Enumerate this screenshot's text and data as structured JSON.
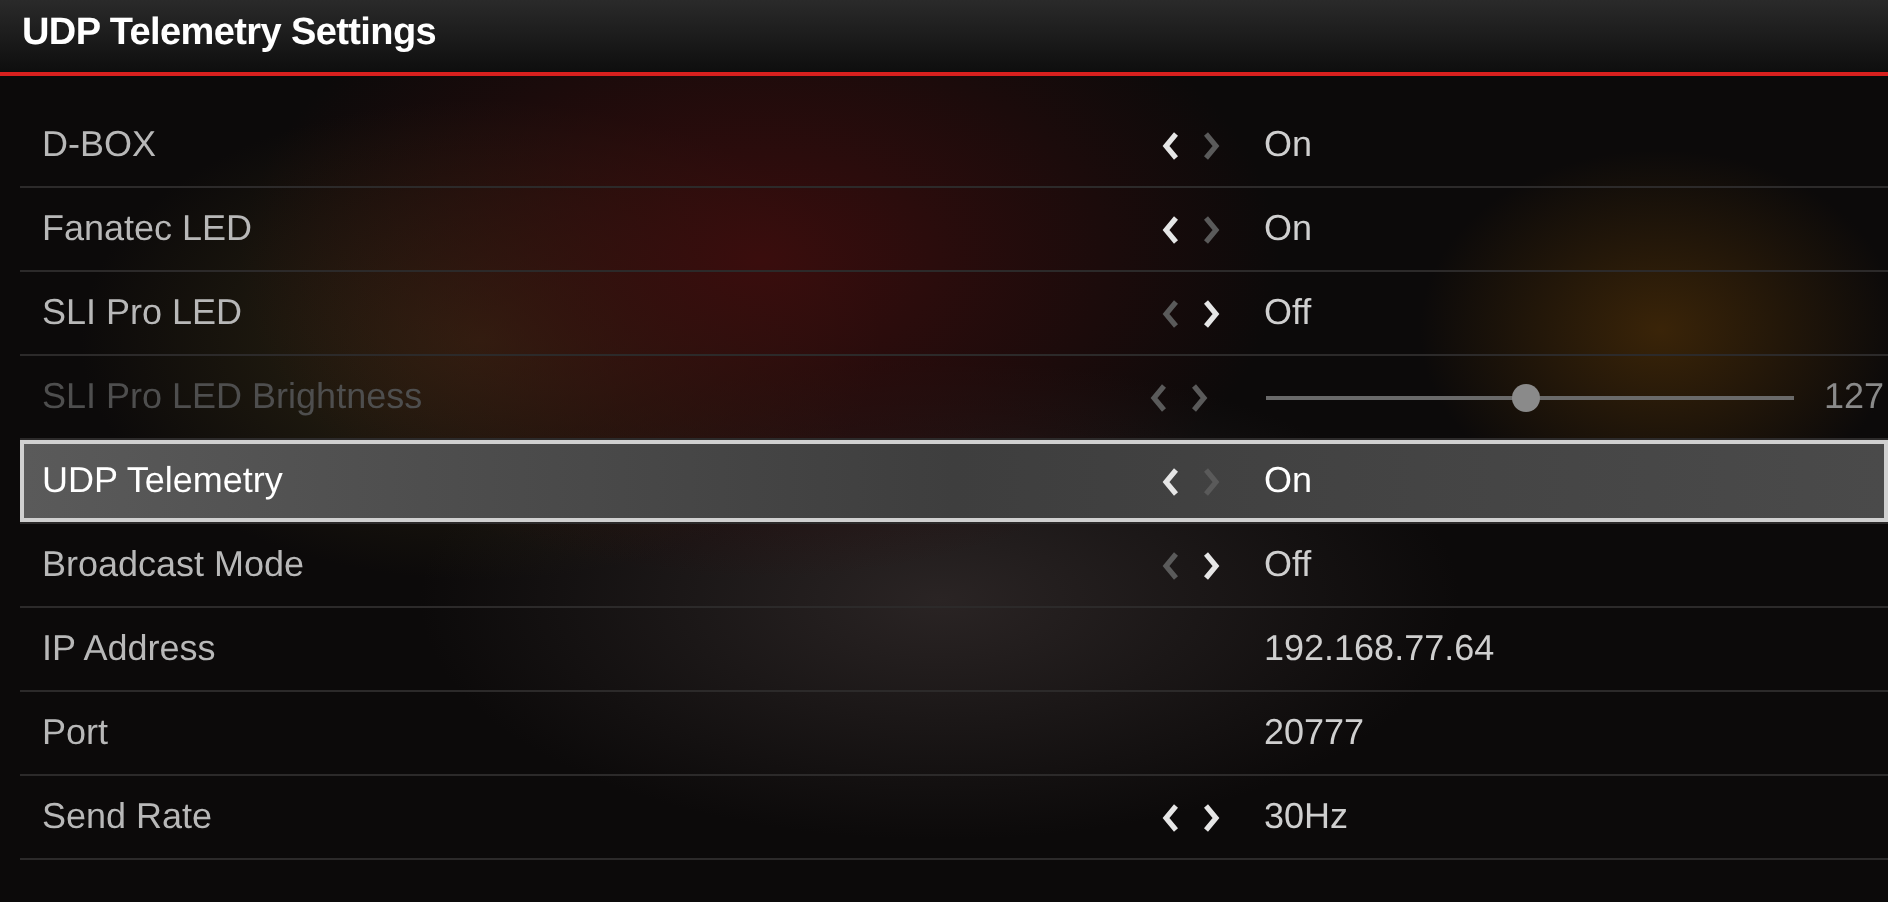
{
  "window": {
    "title": "UDP Telemetry Settings"
  },
  "settings": [
    {
      "label": "D-BOX",
      "kind": "toggle",
      "value": "On",
      "left_enabled": true,
      "right_enabled": false,
      "disabled": false,
      "selected": false
    },
    {
      "label": "Fanatec LED",
      "kind": "toggle",
      "value": "On",
      "left_enabled": true,
      "right_enabled": false,
      "disabled": false,
      "selected": false
    },
    {
      "label": "SLI Pro LED",
      "kind": "toggle",
      "value": "Off",
      "left_enabled": false,
      "right_enabled": true,
      "disabled": false,
      "selected": false
    },
    {
      "label": "SLI Pro LED Brightness",
      "kind": "slider",
      "value": "127",
      "level": 0.5,
      "left_enabled": false,
      "right_enabled": false,
      "disabled": true,
      "selected": false
    },
    {
      "label": "UDP Telemetry",
      "kind": "toggle",
      "value": "On",
      "left_enabled": true,
      "right_enabled": false,
      "disabled": false,
      "selected": true
    },
    {
      "label": "Broadcast Mode",
      "kind": "toggle",
      "value": "Off",
      "left_enabled": false,
      "right_enabled": true,
      "disabled": false,
      "selected": false
    },
    {
      "label": "IP Address",
      "kind": "readonly",
      "value": "192.168.77.64",
      "disabled": false,
      "selected": false
    },
    {
      "label": "Port",
      "kind": "readonly",
      "value": "20777",
      "disabled": false,
      "selected": false
    },
    {
      "label": "Send Rate",
      "kind": "toggle",
      "value": "30Hz",
      "left_enabled": true,
      "right_enabled": true,
      "disabled": false,
      "selected": false
    }
  ]
}
